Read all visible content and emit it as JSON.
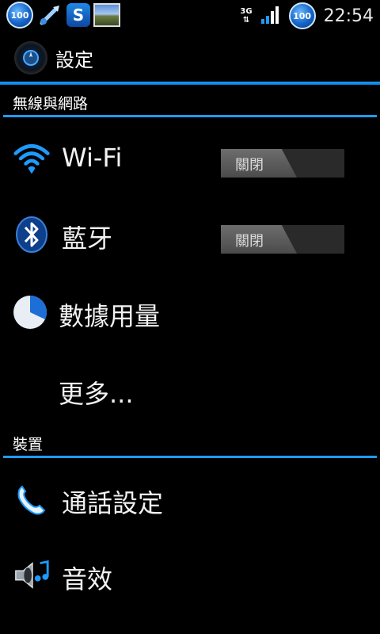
{
  "status_bar": {
    "left_icons": [
      "badge-100-icon",
      "usb-debug-icon",
      "s-app-icon",
      "picture-icon"
    ],
    "badge_left": "100",
    "s_letter": "S",
    "network": "3G",
    "badge_right": "100",
    "time": "22:54"
  },
  "title": {
    "text": "設定"
  },
  "sections": {
    "wireless": {
      "header": "無線與網路"
    },
    "device": {
      "header": "裝置"
    }
  },
  "rows": {
    "wifi": {
      "label": "Wi-Fi",
      "toggle": "關閉"
    },
    "bluetooth": {
      "label": "藍牙",
      "toggle": "關閉"
    },
    "data_usage": {
      "label": "數據用量"
    },
    "more": {
      "label": "更多..."
    },
    "call_settings": {
      "label": "通話設定"
    },
    "sound": {
      "label": "音效"
    }
  },
  "colors": {
    "accent": "#1d9bff",
    "background": "#000000"
  }
}
